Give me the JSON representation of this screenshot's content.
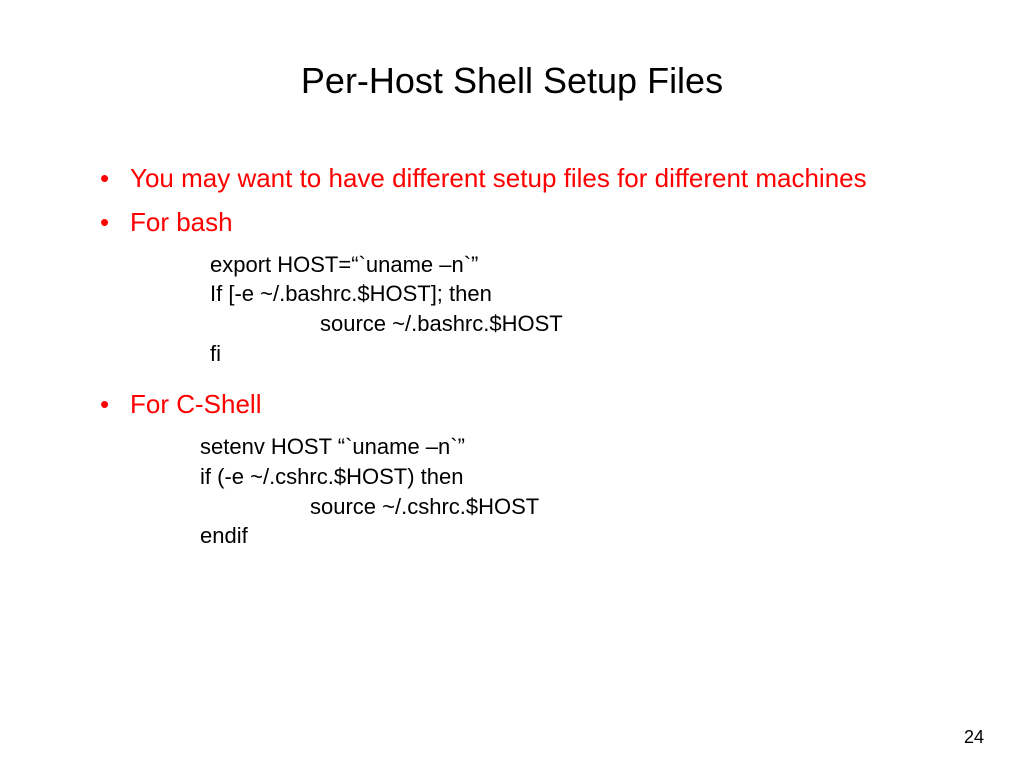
{
  "title": "Per-Host Shell Setup Files",
  "bullets": {
    "item1": "You may want to have different setup files for different machines",
    "item2": "For bash",
    "item3": "For C-Shell"
  },
  "code": {
    "bash": {
      "line1": "export HOST=“`uname –n`”",
      "line2": "If [-e ~/.bashrc.$HOST]; then",
      "line3": "source ~/.bashrc.$HOST",
      "line4": "fi"
    },
    "csh": {
      "line1": "setenv HOST “`uname –n`”",
      "line2": "if (-e ~/.cshrc.$HOST) then",
      "line3": "source ~/.cshrc.$HOST",
      "line4": "endif"
    }
  },
  "page_number": "24"
}
